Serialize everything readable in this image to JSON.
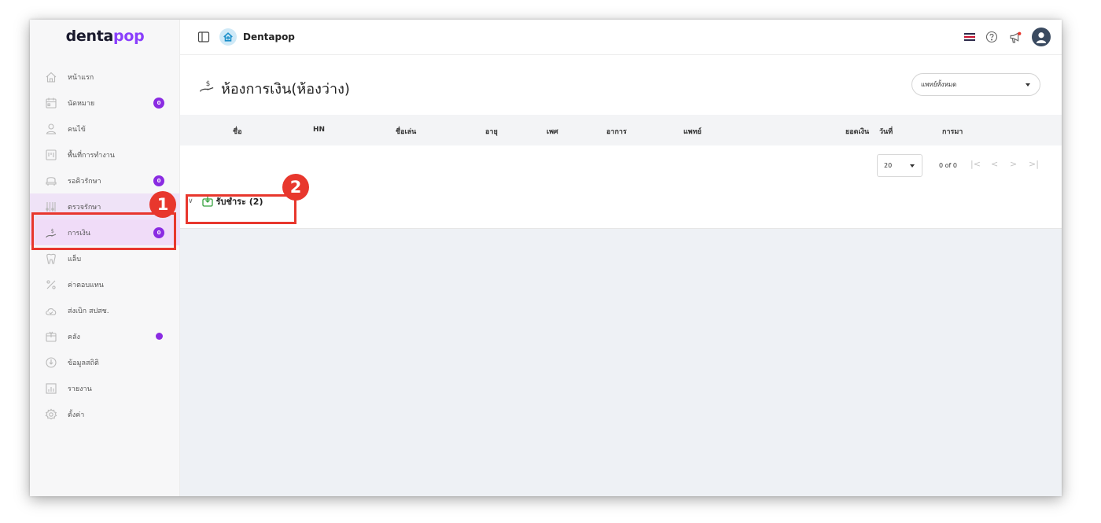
{
  "logo": {
    "part1": "denta",
    "part2": "pop"
  },
  "header": {
    "app_name": "Dentapop",
    "flag_colors": [
      "#2d2a4a",
      "#ffffff",
      "#c8102e",
      "#ffffff",
      "#2d2a4a"
    ]
  },
  "sidebar": {
    "items": [
      {
        "label": "หน้าแรก",
        "icon": "home-icon"
      },
      {
        "label": "นัดหมาย",
        "icon": "calendar-icon",
        "badge": "0"
      },
      {
        "label": "คนไข้",
        "icon": "patient-icon"
      },
      {
        "label": "พื้นที่การทำงาน",
        "icon": "workspace-icon"
      },
      {
        "label": "รอคิวรักษา",
        "icon": "dental-chair-icon",
        "badge": "0"
      },
      {
        "label": "ตรวจรักษา",
        "icon": "dental-tools-icon"
      },
      {
        "label": "การเงิน",
        "icon": "payment-icon",
        "badge": "0"
      },
      {
        "label": "แล็บ",
        "icon": "tooth-icon"
      },
      {
        "label": "ค่าตอบแทน",
        "icon": "percent-icon"
      },
      {
        "label": "ส่งเบิก สปสช.",
        "icon": "cloud-check-icon"
      },
      {
        "label": "คลัง",
        "icon": "box-icon",
        "dot": true
      },
      {
        "label": "ข้อมูลสถิติ",
        "icon": "statistics-icon"
      },
      {
        "label": "รายงาน",
        "icon": "report-chart-icon"
      },
      {
        "label": "ตั้งค่า",
        "icon": "settings-gear-icon"
      }
    ]
  },
  "page": {
    "title": "ห้องการเงิน(ห้องว่าง)",
    "doctor_filter": "แพทย์ทั้งหมด"
  },
  "table": {
    "columns": [
      "ชื่อ",
      "HN",
      "ชื่อเล่น",
      "อายุ",
      "เพศ",
      "อาการ",
      "แพทย์",
      "ยอดเงิน",
      "วันที่",
      "การมา"
    ]
  },
  "pagination": {
    "page_size": "20",
    "info": "0 of 0"
  },
  "group": {
    "label": "รับชำระ (2)"
  },
  "callouts": [
    "1",
    "2"
  ],
  "colors": {
    "accent": "#8a2be2",
    "callout": "#e8372d",
    "success": "#35a23e"
  }
}
